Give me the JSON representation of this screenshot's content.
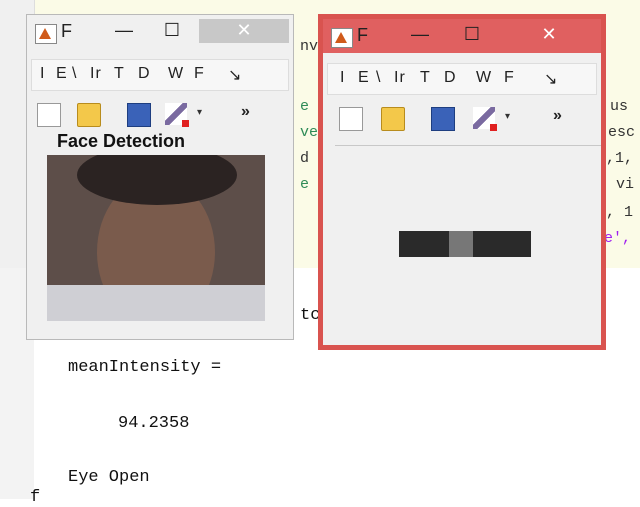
{
  "editor": {
    "lines": [
      {
        "text": "nv",
        "cls": ""
      },
      {
        "text": "e",
        "cls": "code-green"
      },
      {
        "text": "ve",
        "cls": "code-green"
      },
      {
        "text": "d",
        "cls": ""
      },
      {
        "text": "e",
        "cls": "code-green"
      },
      {
        "text": "us",
        "cls": ""
      },
      {
        "text": "esc",
        "cls": ""
      },
      {
        "text": ",1,",
        "cls": ""
      },
      {
        "text": "vi",
        "cls": ""
      },
      {
        "text": ", 1",
        "cls": ""
      },
      {
        "text": "e',",
        "cls": "code-purple"
      },
      {
        "text": "tc",
        "cls": ""
      }
    ]
  },
  "command_window": {
    "var_name": "meanIntensity =",
    "value": "94.2358",
    "status": "Eye Open",
    "prompt": "f"
  },
  "figure1": {
    "title": "F",
    "minimize": "—",
    "maximize": "☐",
    "close": "✕",
    "menu": [
      "I",
      "E",
      "\\",
      "Ir",
      "T",
      "D",
      "W",
      "F",
      "↘"
    ],
    "heading": "Face Detection",
    "overflow": "»",
    "dropdown": "▾"
  },
  "figure2": {
    "title": "F",
    "minimize": "—",
    "maximize": "☐",
    "close": "✕",
    "menu": [
      "I",
      "E",
      "\\",
      "Ir",
      "T",
      "D",
      "W",
      "F",
      "↘"
    ],
    "overflow": "»",
    "dropdown": "▾"
  },
  "colors": {
    "figure2_border": "#d9534f",
    "editor_bg": "#fbfbe7"
  },
  "icons": [
    "matlab-logo-icon",
    "new-file-icon",
    "open-folder-icon",
    "save-icon",
    "brush-icon"
  ]
}
